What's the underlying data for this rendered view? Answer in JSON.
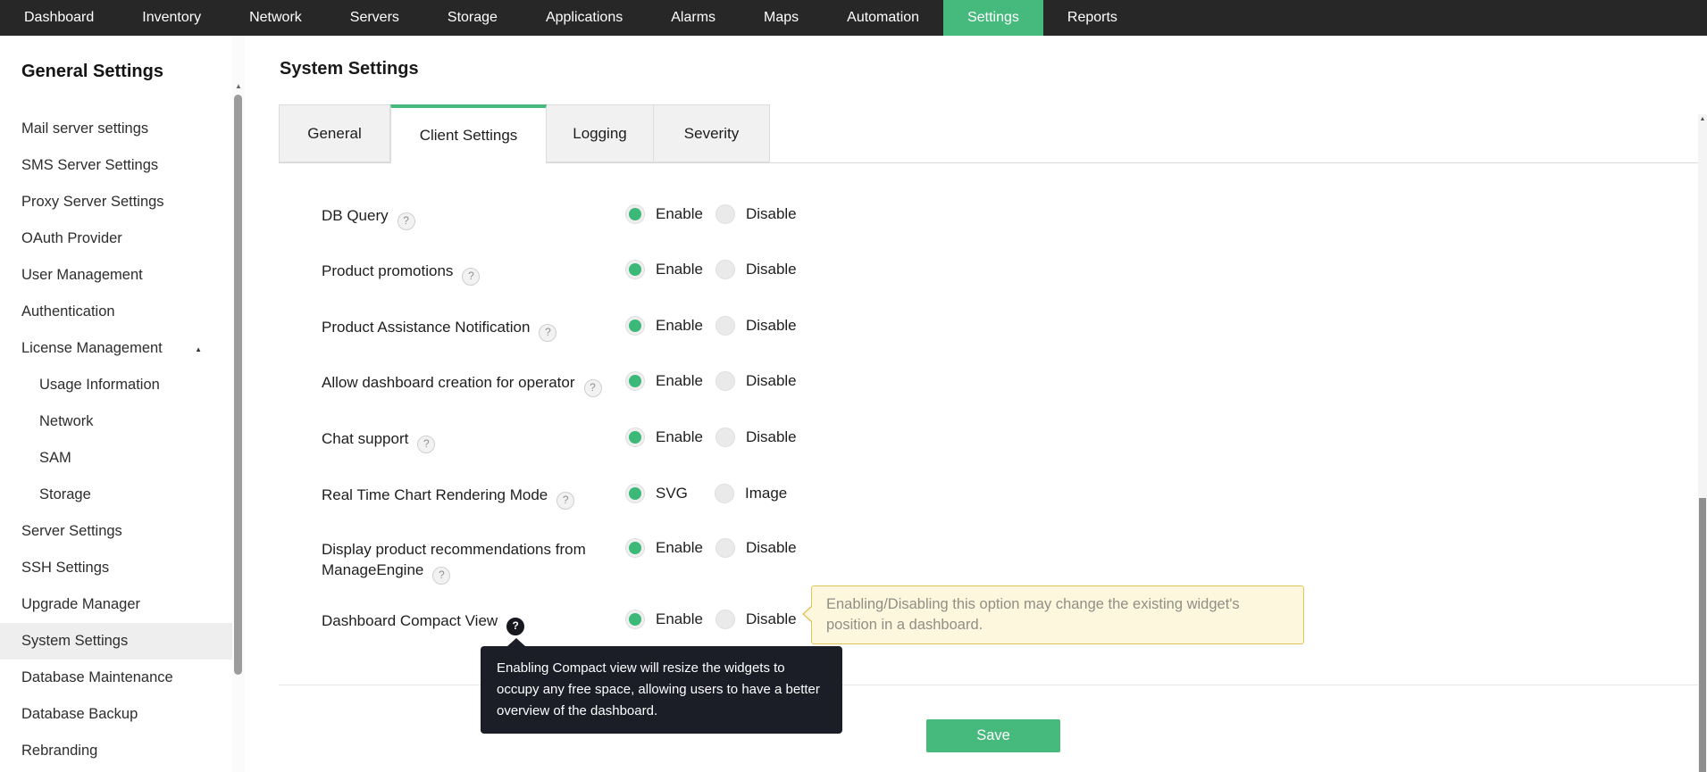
{
  "colors": {
    "green": "#46b97c",
    "nav_bg": "#272727",
    "radio_green": "#3cb878",
    "note_bg": "#fdf7dd",
    "note_border": "#dfc45a",
    "tooltip_bg": "#1b1e27"
  },
  "icons": {
    "help_glyph": "?",
    "caret_up": "▲",
    "scroll_up": "▲"
  },
  "nav": {
    "items": [
      {
        "label": "Dashboard"
      },
      {
        "label": "Inventory"
      },
      {
        "label": "Network"
      },
      {
        "label": "Servers"
      },
      {
        "label": "Storage"
      },
      {
        "label": "Applications"
      },
      {
        "label": "Alarms"
      },
      {
        "label": "Maps"
      },
      {
        "label": "Automation"
      },
      {
        "label": "Settings",
        "active": true
      },
      {
        "label": "Reports"
      }
    ]
  },
  "sidebar": {
    "title": "General Settings",
    "items": [
      {
        "label": "Mail server settings"
      },
      {
        "label": "SMS Server Settings"
      },
      {
        "label": "Proxy Server Settings"
      },
      {
        "label": "OAuth Provider"
      },
      {
        "label": "User Management"
      },
      {
        "label": "Authentication"
      },
      {
        "label": "License Management",
        "expanded": true
      },
      {
        "label": "Usage Information",
        "indent": true
      },
      {
        "label": "Network",
        "indent": true
      },
      {
        "label": "SAM",
        "indent": true
      },
      {
        "label": "Storage",
        "indent": true
      },
      {
        "label": "Server Settings"
      },
      {
        "label": "SSH Settings"
      },
      {
        "label": "Upgrade Manager"
      },
      {
        "label": "System Settings",
        "selected": true
      },
      {
        "label": "Database Maintenance"
      },
      {
        "label": "Database Backup"
      },
      {
        "label": "Rebranding"
      }
    ]
  },
  "main": {
    "title": "System Settings",
    "tabs": [
      {
        "label": "General"
      },
      {
        "label": "Client Settings",
        "active": true
      },
      {
        "label": "Logging"
      },
      {
        "label": "Severity"
      }
    ],
    "settings": [
      {
        "label": "DB Query",
        "options": [
          "Enable",
          "Disable"
        ],
        "selected": "Enable",
        "help": false
      },
      {
        "label": "Product promotions",
        "options": [
          "Enable",
          "Disable"
        ],
        "selected": "Enable",
        "help": true
      },
      {
        "label": "Product Assistance Notification",
        "options": [
          "Enable",
          "Disable"
        ],
        "selected": "Enable",
        "help": false
      },
      {
        "label": "Allow dashboard creation for operator",
        "options": [
          "Enable",
          "Disable"
        ],
        "selected": "Enable",
        "help": false
      },
      {
        "label": "Chat support",
        "options": [
          "Enable",
          "Disable"
        ],
        "selected": "Enable",
        "help": false
      },
      {
        "label": "Real Time Chart Rendering Mode",
        "options": [
          "SVG",
          "Image"
        ],
        "selected": "SVG",
        "help": true
      },
      {
        "label": "Display product recommendations from ManageEngine",
        "options": [
          "Enable",
          "Disable"
        ],
        "selected": "Enable",
        "help": false
      },
      {
        "label": "Dashboard Compact View",
        "options": [
          "Enable",
          "Disable"
        ],
        "selected": "Enable",
        "help": true,
        "help_active": true
      }
    ],
    "note": "Enabling/Disabling this option may change the existing widget's position in a dashboard.",
    "tooltip": "Enabling Compact view will resize the widgets to occupy any free space, allowing users to have a better overview of the dashboard.",
    "save_label": "Save"
  }
}
